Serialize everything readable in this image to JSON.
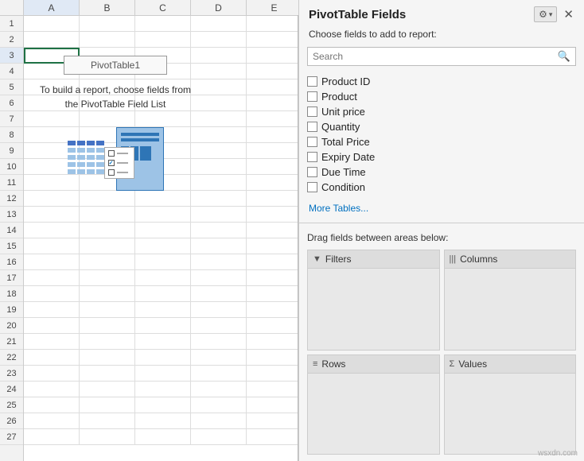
{
  "spreadsheet": {
    "col_headers": [
      "A",
      "B",
      "C",
      "D",
      "E"
    ],
    "row_count": 27,
    "pivot_table_label": "PivotTable1",
    "pivot_instruction": "To build a report, choose fields from the PivotTable Field List"
  },
  "panel": {
    "title": "PivotTable Fields",
    "subtitle": "Choose fields to add to report:",
    "search_placeholder": "Search",
    "fields": [
      {
        "label": "Product ID",
        "checked": false
      },
      {
        "label": "Product",
        "checked": false
      },
      {
        "label": "Unit price",
        "checked": false
      },
      {
        "label": "Quantity",
        "checked": false
      },
      {
        "label": "Total Price",
        "checked": false
      },
      {
        "label": "Expiry Date",
        "checked": false
      },
      {
        "label": "Due Time",
        "checked": false
      },
      {
        "label": "Condition",
        "checked": false
      }
    ],
    "more_tables": "More Tables...",
    "drag_section_label": "Drag fields between areas below:",
    "areas": [
      {
        "icon": "▼",
        "label": "Filters"
      },
      {
        "icon": "|||",
        "label": "Columns"
      },
      {
        "icon": "≡",
        "label": "Rows"
      },
      {
        "icon": "Σ",
        "label": "Values"
      }
    ]
  },
  "watermark": "wsxdn.com"
}
